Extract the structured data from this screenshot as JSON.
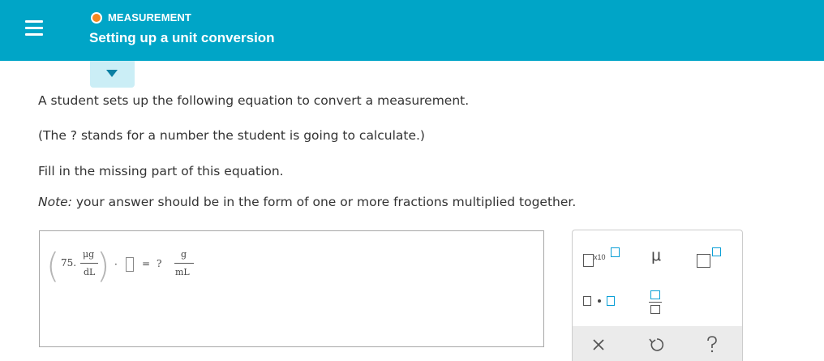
{
  "header": {
    "topic": "MEASUREMENT",
    "title": "Setting up a unit conversion",
    "topic_dot_color": "#f5871f",
    "background_color": "#00a5c7"
  },
  "question": {
    "line1": "A student sets up the following equation to convert a measurement.",
    "line2": "(The ? stands for a number the student is going to calculate.)",
    "line3": "Fill in the missing part of this equation.",
    "note_label": "Note:",
    "note_text": " your answer should be in the form of one or more fractions multiplied together."
  },
  "equation": {
    "coefficient": "75.",
    "unit_numerator": "μg",
    "unit_denominator": "dL",
    "multiply": "·",
    "equals": "=",
    "unknown": "?",
    "result_numerator": "g",
    "result_denominator": "mL"
  },
  "keypad": {
    "x10_label": "x10",
    "mu_label": "μ",
    "icons": {
      "superscript": "superscript-box-icon",
      "times_ten": "times-ten-power-icon",
      "mu": "mu-symbol-icon",
      "multiply_dot": "multiply-dot-icon",
      "fraction": "fraction-icon",
      "clear": "close-icon",
      "undo": "undo-icon",
      "help": "question-mark-icon"
    }
  }
}
